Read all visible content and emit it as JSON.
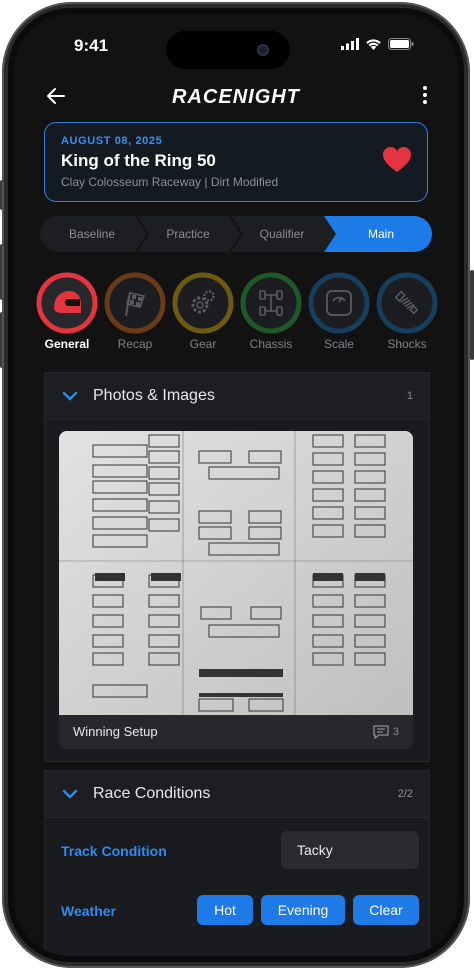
{
  "status_bar": {
    "time": "9:41"
  },
  "header": {
    "logo": "RACENIGHT"
  },
  "event": {
    "date": "AUGUST 08, 2025",
    "title": "King of the Ring 50",
    "subtitle": "Clay Colosseum Raceway | Dirt Modified"
  },
  "sessions": [
    "Baseline",
    "Practice",
    "Qualifier",
    "Main"
  ],
  "active_session": "Main",
  "categories": [
    {
      "label": "General",
      "icon": "helmet-icon",
      "color": "#e4343d",
      "progress": 1.0
    },
    {
      "label": "Recap",
      "icon": "checkered-flag-icon",
      "color": "#6b3a16",
      "progress": 1.0
    },
    {
      "label": "Gear",
      "icon": "gear-icon",
      "color": "#6b5a10",
      "progress": 1.0
    },
    {
      "label": "Chassis",
      "icon": "chassis-icon",
      "color": "#1d5a26",
      "progress": 1.0
    },
    {
      "label": "Scale",
      "icon": "scale-icon",
      "color": "#173e5c",
      "progress": 1.0
    },
    {
      "label": "Shocks",
      "icon": "shock-absorber-icon",
      "color": "#173e5c",
      "progress": 1.0
    }
  ],
  "photos": {
    "title": "Photos & Images",
    "count": "1",
    "caption": "Winning Setup",
    "comments": "3"
  },
  "conditions": {
    "title": "Race Conditions",
    "count": "2/2",
    "track_label": "Track Condition",
    "track_value": "Tacky",
    "weather_label": "Weather",
    "weather_chips": [
      "Hot",
      "Evening",
      "Clear"
    ]
  },
  "colors": {
    "accent": "#1c7be6",
    "card_border": "#2f7fe0",
    "heart": "#e63340"
  }
}
